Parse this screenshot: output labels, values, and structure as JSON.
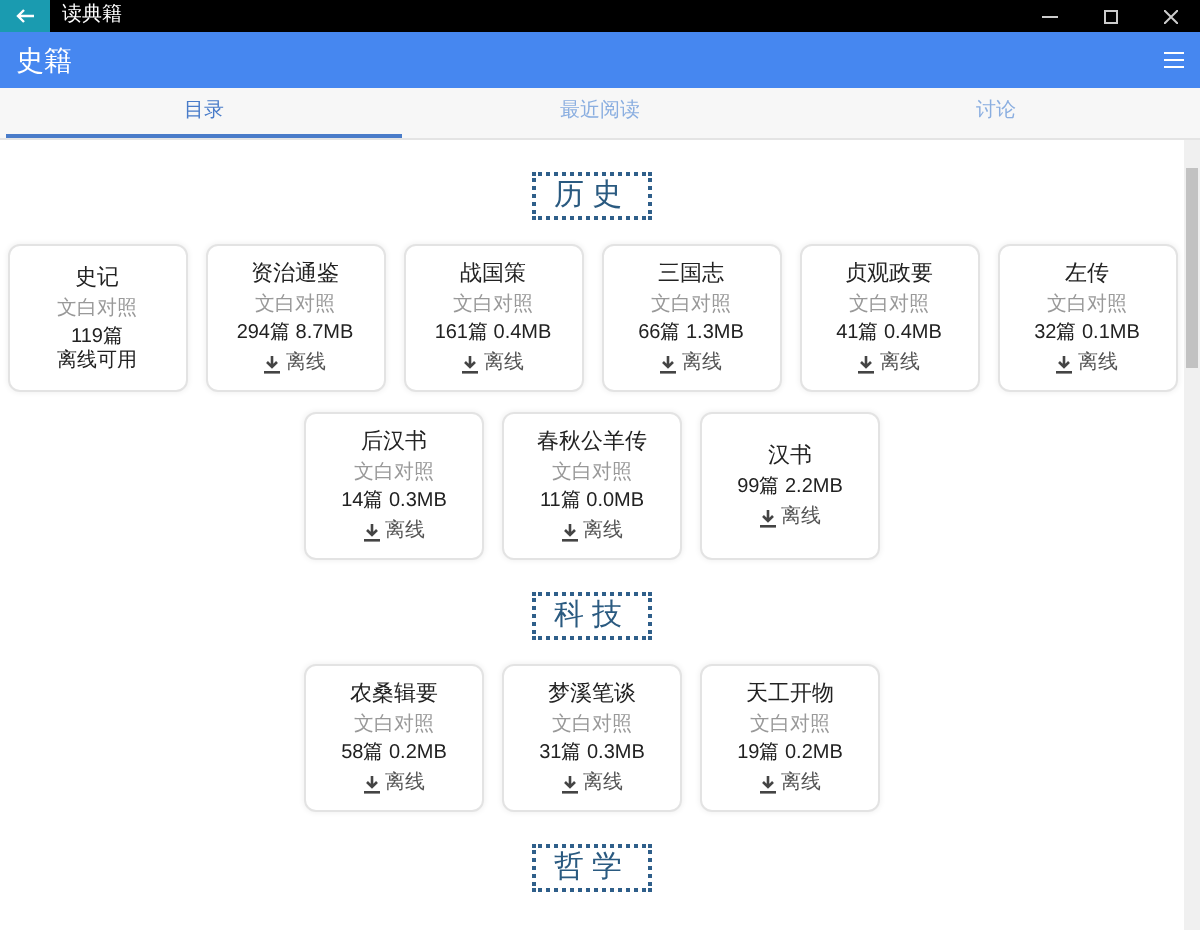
{
  "window": {
    "title": "读典籍"
  },
  "header": {
    "title": "史籍"
  },
  "tabs": [
    {
      "label": "目录",
      "selected": true
    },
    {
      "label": "最近阅读",
      "selected": false
    },
    {
      "label": "讨论",
      "selected": false
    }
  ],
  "sections": [
    {
      "title": "历史",
      "books": [
        {
          "kind": "downloaded",
          "title": "史记",
          "subtitle": "文白对照",
          "stats": "119篇",
          "status": "离线可用"
        },
        {
          "kind": "download",
          "title": "资治通鉴",
          "subtitle": "文白对照",
          "stats": "294篇 8.7MB",
          "action": "离线"
        },
        {
          "kind": "download",
          "title": "战国策",
          "subtitle": "文白对照",
          "stats": "161篇 0.4MB",
          "action": "离线"
        },
        {
          "kind": "download",
          "title": "三国志",
          "subtitle": "文白对照",
          "stats": "66篇 1.3MB",
          "action": "离线"
        },
        {
          "kind": "download",
          "title": "贞观政要",
          "subtitle": "文白对照",
          "stats": "41篇 0.4MB",
          "action": "离线"
        },
        {
          "kind": "download",
          "title": "左传",
          "subtitle": "文白对照",
          "stats": "32篇 0.1MB",
          "action": "离线"
        },
        {
          "kind": "download",
          "title": "后汉书",
          "subtitle": "文白对照",
          "stats": "14篇 0.3MB",
          "action": "离线"
        },
        {
          "kind": "download",
          "title": "春秋公羊传",
          "subtitle": "文白对照",
          "stats": "11篇 0.0MB",
          "action": "离线"
        },
        {
          "kind": "download",
          "title": "汉书",
          "stats": "99篇 2.2MB",
          "action": "离线"
        }
      ]
    },
    {
      "title": "科技",
      "books": [
        {
          "kind": "download",
          "title": "农桑辑要",
          "subtitle": "文白对照",
          "stats": "58篇 0.2MB",
          "action": "离线"
        },
        {
          "kind": "download",
          "title": "梦溪笔谈",
          "subtitle": "文白对照",
          "stats": "31篇 0.3MB",
          "action": "离线"
        },
        {
          "kind": "download",
          "title": "天工开物",
          "subtitle": "文白对照",
          "stats": "19篇 0.2MB",
          "action": "离线"
        }
      ]
    },
    {
      "title": "哲学"
    }
  ]
}
